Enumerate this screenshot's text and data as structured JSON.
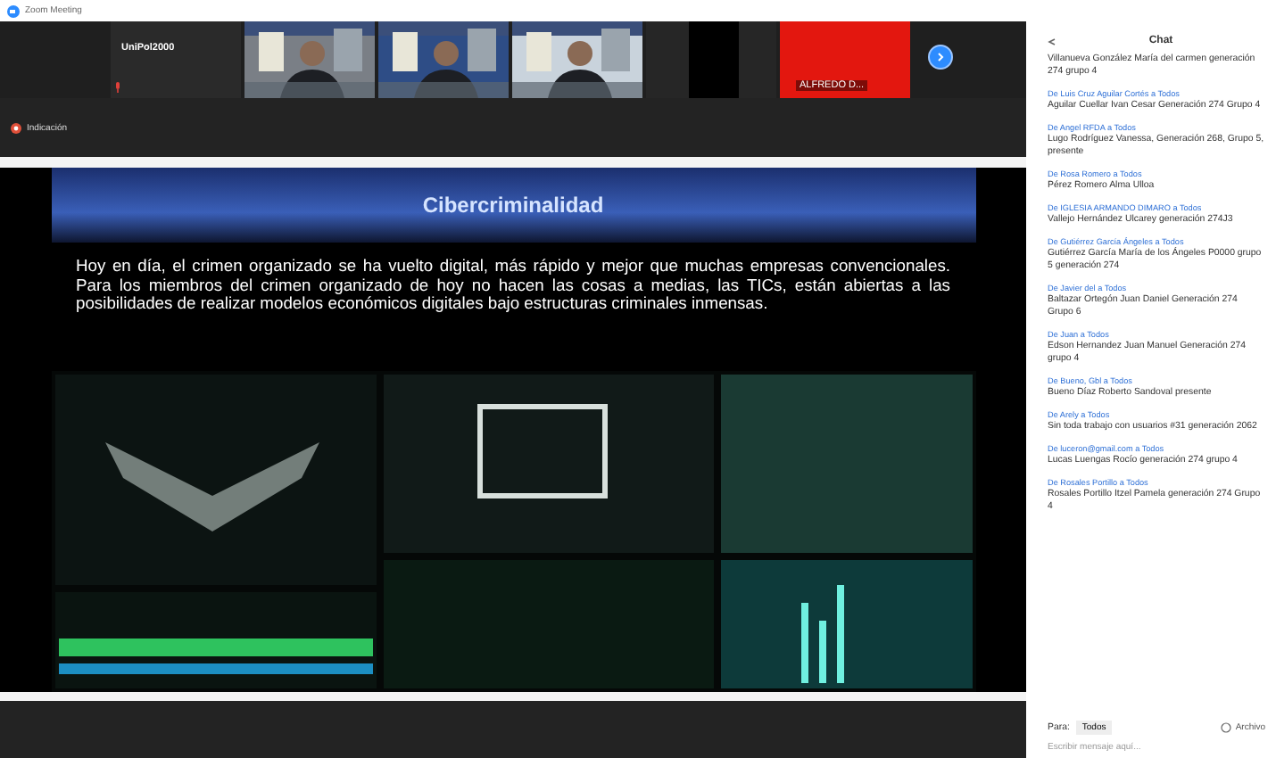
{
  "window": {
    "title": "Zoom Meeting"
  },
  "participants": [
    {
      "kind": "name",
      "name": "UniPol2000"
    },
    {
      "kind": "video"
    },
    {
      "kind": "video"
    },
    {
      "kind": "video"
    },
    {
      "kind": "blank"
    },
    {
      "kind": "red",
      "name": "ALFREDO D..."
    }
  ],
  "indicator": {
    "label": "Indicación"
  },
  "slide": {
    "title": "Cibercriminalidad",
    "body": "Hoy en día, el crimen organizado se ha vuelto digital, más rápido y mejor que muchas empresas convencionales. Para los miembros del crimen organizado de hoy no hacen las cosas a medias, las TICs, están abiertas a las posibilidades de realizar modelos económicos digitales bajo estructuras criminales inmensas."
  },
  "chat": {
    "title": "Chat",
    "messages": [
      {
        "text": "Villanueva González María del carmen generación 274 grupo 4"
      },
      {
        "sender": "De Luis Cruz Aguilar Cortés a Todos",
        "text": "Aguilar Cuellar Ivan Cesar Generación 274 Grupo 4"
      },
      {
        "sender": "De Angel RFDA a Todos",
        "text": "Lugo Rodríguez Vanessa, Generación 268, Grupo 5, presente"
      },
      {
        "sender": "De Rosa Romero a Todos",
        "text": "Pérez Romero Alma Ulloa"
      },
      {
        "sender": "De IGLESIA ARMANDO DIMARO a Todos",
        "text": "Vallejo Hernández Ulcarey generación 274J3"
      },
      {
        "sender": "De Gutiérrez García Ángeles a Todos",
        "text": "Gutiérrez García María de los Ángeles P0000 grupo 5 generación 274"
      },
      {
        "sender": "De Javier del a Todos",
        "text": "Baltazar Ortegón Juan Daniel Generación 274 Grupo 6"
      },
      {
        "sender": "De Juan a Todos",
        "text": "Edson Hernandez Juan Manuel Generación 274 grupo 4"
      },
      {
        "sender": "De Bueno, Gbl a Todos",
        "text": "Bueno Díaz Roberto Sandoval presente"
      },
      {
        "sender": "De Arely a Todos",
        "text": "Sin toda trabajo con usuarios #31 generación 2062"
      },
      {
        "sender": "De luceron@gmail.com a Todos",
        "text": "Lucas Luengas Rocío generación 274 grupo 4"
      },
      {
        "sender": "De Rosales Portillo a Todos",
        "text": "Rosales Portillo Itzel Pamela generación 274 Grupo 4"
      }
    ],
    "to_label": "Para:",
    "to_value": "Todos",
    "file_button": "Archivo",
    "placeholder": "Escribir mensaje aquí..."
  }
}
